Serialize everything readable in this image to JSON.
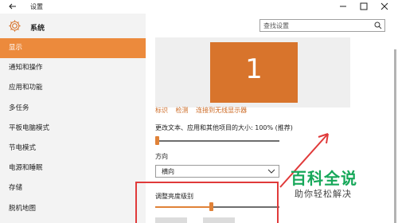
{
  "window": {
    "title": "设置"
  },
  "sidebar": {
    "header_label": "系统",
    "items": [
      {
        "label": "显示",
        "active": true
      },
      {
        "label": "通知和操作",
        "active": false
      },
      {
        "label": "应用和功能",
        "active": false
      },
      {
        "label": "多任务",
        "active": false
      },
      {
        "label": "平板电脑模式",
        "active": false
      },
      {
        "label": "节电模式",
        "active": false
      },
      {
        "label": "电源和睡眠",
        "active": false
      },
      {
        "label": "存储",
        "active": false
      },
      {
        "label": "脱机地图",
        "active": false
      }
    ]
  },
  "search": {
    "placeholder": "查找设置"
  },
  "display": {
    "monitor_number": "1",
    "links": {
      "identify": "标识",
      "detect": "检测",
      "wireless": "连接到无线显示器"
    },
    "scale_label": "更改文本、应用和其他项目的大小: 100% (推荐)",
    "scale_value_fraction": 0.0,
    "orientation_label": "方向",
    "orientation_value": "横向",
    "brightness_label": "调整亮度级别",
    "brightness_value_fraction": 0.45
  },
  "watermark": {
    "main": "百科全说",
    "sub": "助你轻松解决"
  },
  "colors": {
    "accent": "#ec8a3c",
    "annotation": "#e03a3a",
    "brand": "#17a85a"
  }
}
